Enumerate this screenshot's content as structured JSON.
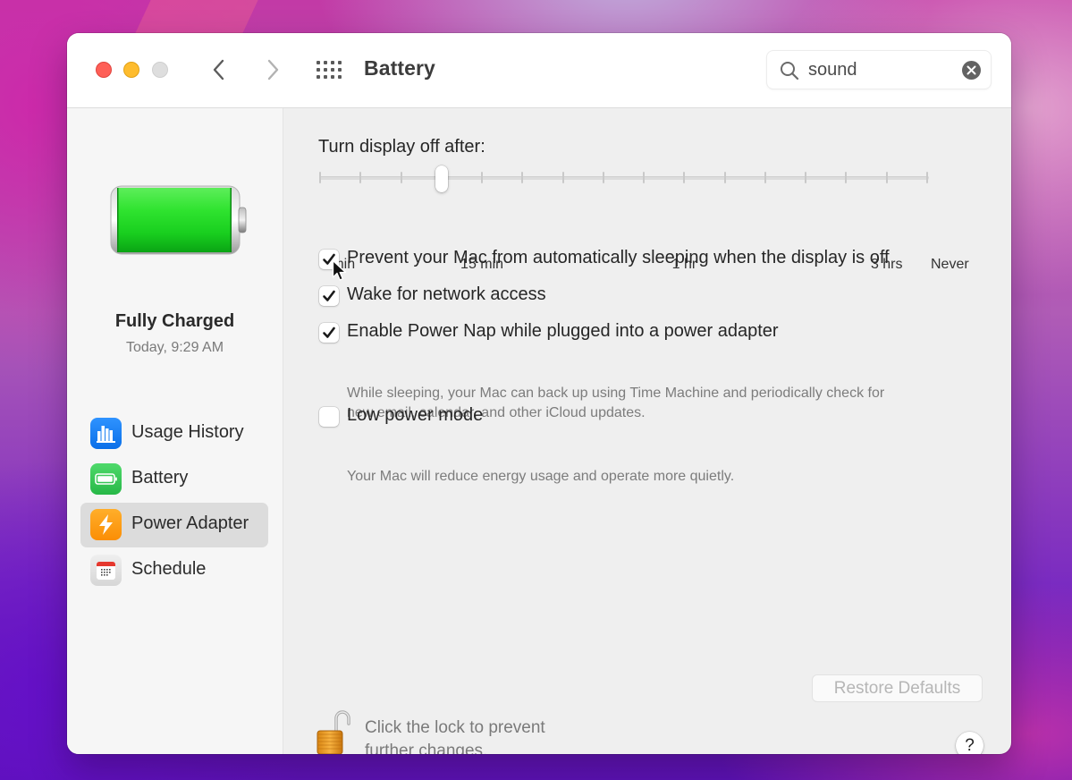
{
  "window": {
    "title": "Battery",
    "traffic_lights": [
      {
        "name": "close",
        "color": "#fe5f57"
      },
      {
        "name": "minimize",
        "color": "#febc2e"
      },
      {
        "name": "zoom",
        "color": "#dedede"
      }
    ],
    "nav": {
      "back_icon": "chevron-left-icon",
      "forward_icon": "chevron-right-icon",
      "grid_icon": "show-all-grid-icon"
    }
  },
  "search": {
    "value": "sound",
    "placeholder": "Search",
    "icon": "magnifying-glass-icon",
    "clear_icon": "clear-x-circle-icon"
  },
  "sidebar": {
    "battery_status": {
      "title": "Fully Charged",
      "time": "Today, 9:29 AM",
      "charge_fraction": 1.0,
      "fill_color": "#1fd32a"
    },
    "items": [
      {
        "label": "Usage History",
        "icon": "bar-chart-icon",
        "icon_color": "#1a82fb",
        "selected": false
      },
      {
        "label": "Battery",
        "icon": "battery-icon",
        "icon_color": "#34c759",
        "selected": false
      },
      {
        "label": "Power Adapter",
        "icon": "lightning-bolt-icon",
        "icon_color": "#fe9a0a",
        "selected": true
      },
      {
        "label": "Schedule",
        "icon": "calendar-icon",
        "icon_color": "#e8e8e8",
        "selected": false
      }
    ]
  },
  "content": {
    "display_off": {
      "label": "Turn display off after:",
      "tick_count": 16,
      "selected_index": 3,
      "tick_labels": [
        {
          "text": "1 min",
          "index": 0
        },
        {
          "text": "15 min",
          "index": 4
        },
        {
          "text": "1 hr",
          "index": 9
        },
        {
          "text": "3 hrs",
          "index": 14
        },
        {
          "text": "Never",
          "index": 15
        }
      ]
    },
    "options": [
      {
        "label": "Prevent your Mac from automatically sleeping when the display is off",
        "checked": true,
        "help": ""
      },
      {
        "label": "Wake for network access",
        "checked": true,
        "help": ""
      },
      {
        "label": "Enable Power Nap while plugged into a power adapter",
        "checked": true,
        "help_lines": [
          "While sleeping, your Mac can back up using Time Machine and periodically check for",
          "new email, calendar, and other iCloud updates."
        ]
      },
      {
        "label": "Low power mode",
        "checked": false,
        "help_lines": [
          "Your Mac will reduce energy usage and operate more quietly."
        ]
      }
    ],
    "restore_defaults_label": "Restore Defaults",
    "restore_defaults_enabled": false,
    "lock": {
      "state": "unlocked",
      "icon": "open-padlock-icon",
      "text_lines": [
        "Click the lock to prevent",
        "further changes."
      ]
    },
    "help_label": "?"
  }
}
